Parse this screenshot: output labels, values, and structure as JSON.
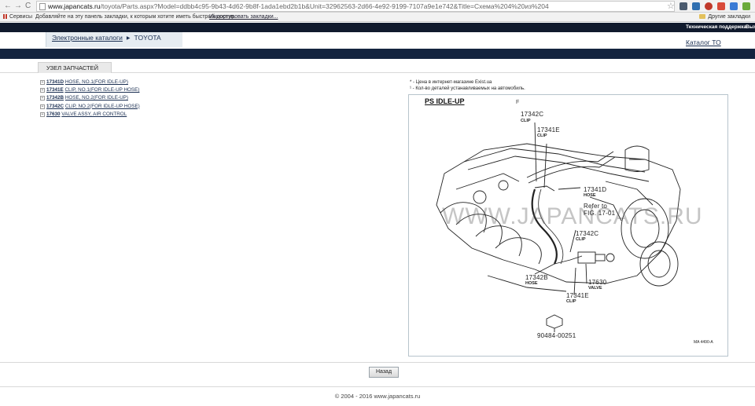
{
  "browser": {
    "nav_back": "←",
    "nav_forward": "→",
    "nav_reload": "C",
    "url_domain": "www.japancats.ru",
    "url_rest": "/toyota/Parts.aspx?Model=ddbb4c95-9b43-4d62-9b8f-1ada1ebd2b1b&Unit=32962563-2d66-4e92-9199-7107a9e1e742&Title=Схема%204%20из%204",
    "star": "☆"
  },
  "bookmarks": {
    "apps_label": "Сервисы",
    "message": "Добавляйте на эту панель закладки, к которым хотите иметь быстрый доступ.",
    "import_link": "Импортировать закладки...",
    "other": "Другие закладки"
  },
  "site": {
    "support": "Техническая поддержка",
    "exit": "Вых",
    "crumb_catalogs": "Электронные каталоги",
    "crumb_brand": "TOYOTA",
    "catalog_to": "Каталог ТО"
  },
  "section": {
    "title": "УЗЕЛ ЗАПЧАСТЕЙ"
  },
  "parts": [
    {
      "code": "17341D",
      "name": "HOSE, NO.1(FOR IDLE-UP)"
    },
    {
      "code": "17341E",
      "name": "CLIP, NO.1(FOR IDLE-UP HOSE)"
    },
    {
      "code": "17342B",
      "name": "HOSE, NO.2(FOR IDLE-UP)"
    },
    {
      "code": "17342C",
      "name": "CLIP, NO.2(FOR IDLE-UP HOSE)"
    },
    {
      "code": "17630",
      "name": "VALVE ASSY, AIR CONTROL"
    }
  ],
  "notes": [
    "* - Цена в интернет-магазине Exist.ua",
    "¹ - Кол-во деталей устанавливаемых на автомобиль."
  ],
  "diagram": {
    "title": "PS  IDLE-UP",
    "fig_mark": "F",
    "watermark": "WWW.JAPANCATS.RU",
    "labels": {
      "c1": "17342C",
      "c1_sub": "CLIP",
      "e1": "17341E",
      "e1_sub": "CLIP",
      "d1": "17341D",
      "d1_sub": "HOSE",
      "ref1": "Refer to",
      "ref2": "FIG. 17-01",
      "c2": "17342C",
      "c2_sub": "CLIP",
      "b1": "17342B",
      "b1_sub": "HOSE",
      "v1": "17630",
      "v1_sub": "VALVE",
      "e2": "17341E",
      "e2_sub": "CLIP",
      "bolt": "90484-00251",
      "ma": "MA  4490-A"
    }
  },
  "footer": {
    "back_label": "Назад",
    "copyright": "© 2004 - 2016 www.japancats.ru"
  }
}
